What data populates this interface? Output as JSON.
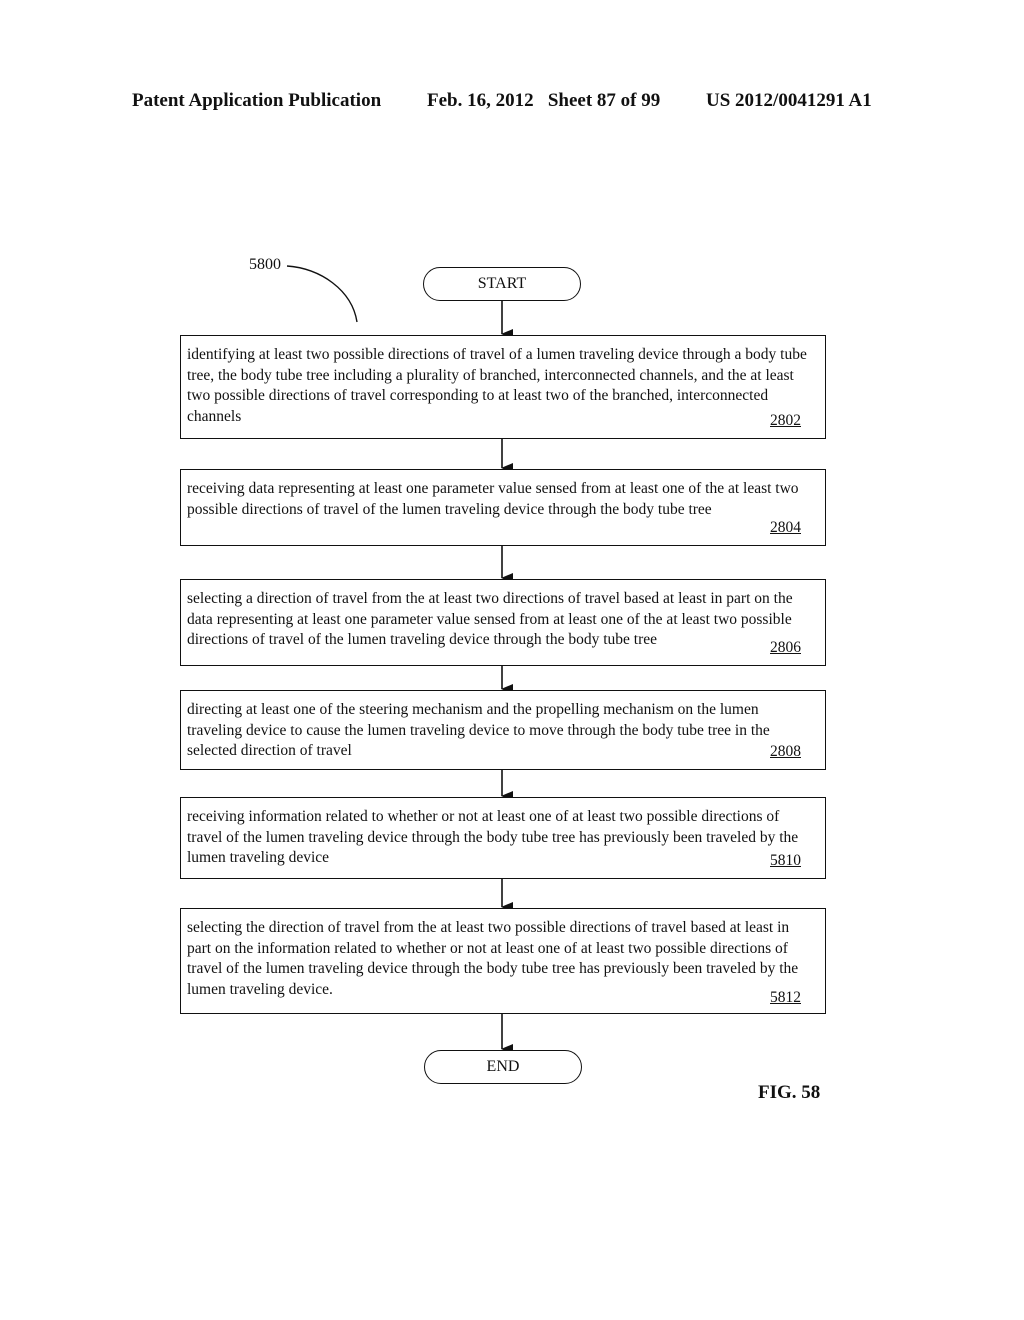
{
  "header": {
    "publication": "Patent Application Publication",
    "date_sheet": "Feb. 16, 2012   Sheet 87 of 99",
    "number": "US 2012/0041291 A1"
  },
  "diagram": {
    "reference_label": "5800",
    "start_label": "START",
    "end_label": "END",
    "figure_label": "FIG. 58",
    "steps": [
      {
        "text": "identifying at least two possible directions of travel of a lumen traveling device through a body tube tree, the body tube tree including a plurality of branched, interconnected channels, and the at least two possible directions of travel corresponding to at least two of the branched, interconnected channels",
        "number": "2802"
      },
      {
        "text": "receiving data representing at least one parameter value sensed from at least one of the at least two possible directions of travel of the lumen traveling device through the body tube tree",
        "number": "2804"
      },
      {
        "text": "selecting a direction of travel from the at least two directions of travel based at least in part on the data representing at least one parameter value sensed from at least one of the at least two possible directions of travel of the lumen traveling device through the body tube tree",
        "number": "2806"
      },
      {
        "text": "directing at least one of the steering mechanism and the propelling mechanism on the lumen traveling device to cause the lumen traveling device to move through the body tube tree in the selected direction of travel",
        "number": "2808"
      },
      {
        "text": "receiving information related to whether or not at least one of at least two possible directions of travel of the lumen traveling device through the body tube tree has previously been traveled by the lumen traveling device",
        "number": "5810"
      },
      {
        "text": "selecting the direction of travel from the at least two possible directions of travel based at least in part on the information related to whether or not at least one of at least two possible directions of travel of the lumen traveling device through the body tube tree has previously been traveled by the lumen traveling device.",
        "number": "5812"
      }
    ]
  }
}
